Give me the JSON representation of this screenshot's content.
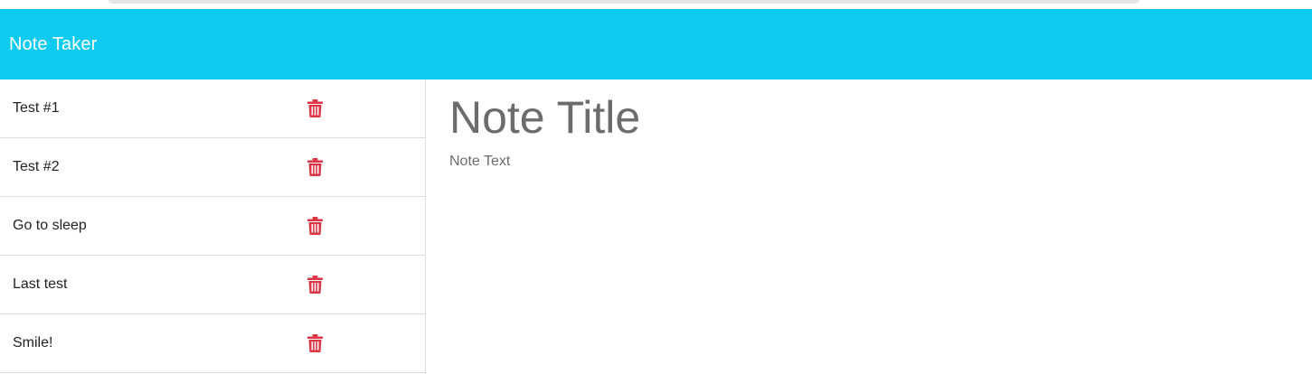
{
  "app": {
    "brand": "Note Taker",
    "header_color": "#0dcaf0"
  },
  "notes": [
    {
      "title": "Test #1",
      "delete_icon": "trash-icon"
    },
    {
      "title": "Test #2",
      "delete_icon": "trash-icon"
    },
    {
      "title": "Go to sleep",
      "delete_icon": "trash-icon"
    },
    {
      "title": "Last test",
      "delete_icon": "trash-icon"
    },
    {
      "title": "Smile!",
      "delete_icon": "trash-icon"
    }
  ],
  "editor": {
    "title_placeholder": "Note Title",
    "text_placeholder": "Note Text"
  },
  "colors": {
    "delete_icon": "#dc3545",
    "placeholder": "#6c6c6c"
  }
}
